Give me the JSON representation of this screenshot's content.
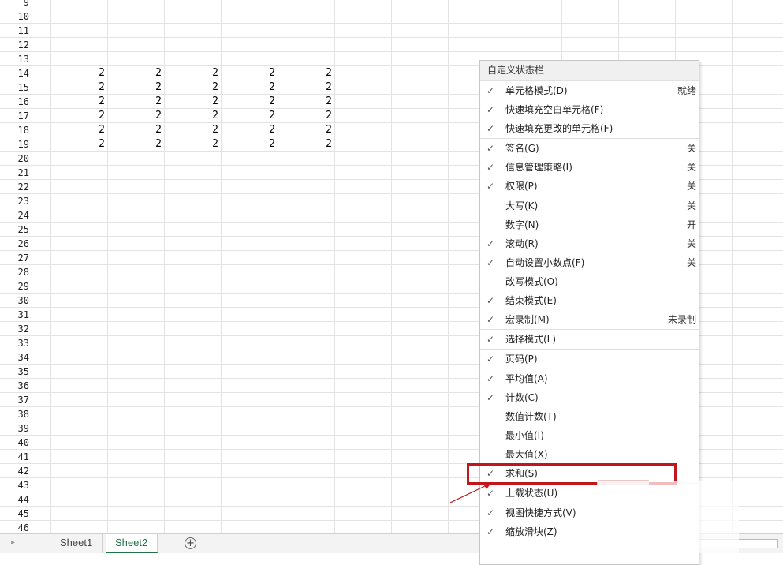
{
  "sheet": {
    "rows": [
      {
        "num": "9",
        "cells": []
      },
      {
        "num": "10",
        "cells": []
      },
      {
        "num": "11",
        "cells": []
      },
      {
        "num": "12",
        "cells": []
      },
      {
        "num": "13",
        "cells": []
      },
      {
        "num": "14",
        "cells": [
          "2",
          "2",
          "2",
          "2",
          "2"
        ]
      },
      {
        "num": "15",
        "cells": [
          "2",
          "2",
          "2",
          "2",
          "2"
        ]
      },
      {
        "num": "16",
        "cells": [
          "2",
          "2",
          "2",
          "2",
          "2"
        ]
      },
      {
        "num": "17",
        "cells": [
          "2",
          "2",
          "2",
          "2",
          "2"
        ]
      },
      {
        "num": "18",
        "cells": [
          "2",
          "2",
          "2",
          "2",
          "2"
        ]
      },
      {
        "num": "19",
        "cells": [
          "2",
          "2",
          "2",
          "2",
          "2"
        ]
      },
      {
        "num": "20",
        "cells": []
      },
      {
        "num": "21",
        "cells": []
      },
      {
        "num": "22",
        "cells": []
      },
      {
        "num": "23",
        "cells": []
      },
      {
        "num": "24",
        "cells": []
      },
      {
        "num": "25",
        "cells": []
      },
      {
        "num": "26",
        "cells": []
      },
      {
        "num": "27",
        "cells": []
      },
      {
        "num": "28",
        "cells": []
      },
      {
        "num": "29",
        "cells": []
      },
      {
        "num": "30",
        "cells": []
      },
      {
        "num": "31",
        "cells": []
      },
      {
        "num": "32",
        "cells": []
      },
      {
        "num": "33",
        "cells": []
      },
      {
        "num": "34",
        "cells": []
      },
      {
        "num": "35",
        "cells": []
      },
      {
        "num": "36",
        "cells": []
      },
      {
        "num": "37",
        "cells": []
      },
      {
        "num": "38",
        "cells": []
      },
      {
        "num": "39",
        "cells": []
      },
      {
        "num": "40",
        "cells": []
      },
      {
        "num": "41",
        "cells": []
      },
      {
        "num": "42",
        "cells": []
      },
      {
        "num": "43",
        "cells": []
      },
      {
        "num": "44",
        "cells": []
      },
      {
        "num": "45",
        "cells": []
      },
      {
        "num": "46",
        "cells": []
      }
    ]
  },
  "tabs": {
    "sheet1": "Sheet1",
    "sheet2": "Sheet2"
  },
  "icons": {
    "add_sheet": "plus-circle-icon",
    "nav": "chevron-right-icon",
    "check": "checkmark-icon"
  },
  "menu": {
    "title": "自定义状态栏",
    "items": [
      {
        "checked": true,
        "label": "单元格模式(D)",
        "value": "就绪",
        "sep": false
      },
      {
        "checked": true,
        "label": "快速填充空白单元格(F)",
        "value": "",
        "sep": false
      },
      {
        "checked": true,
        "label": "快速填充更改的单元格(F)",
        "value": "",
        "sep": false
      },
      {
        "checked": true,
        "label": "签名(G)",
        "value": "关",
        "sep": true
      },
      {
        "checked": true,
        "label": "信息管理策略(I)",
        "value": "关",
        "sep": false
      },
      {
        "checked": true,
        "label": "权限(P)",
        "value": "关",
        "sep": false
      },
      {
        "checked": false,
        "label": "大写(K)",
        "value": "关",
        "sep": true
      },
      {
        "checked": false,
        "label": "数字(N)",
        "value": "开",
        "sep": false
      },
      {
        "checked": true,
        "label": "滚动(R)",
        "value": "关",
        "sep": false
      },
      {
        "checked": true,
        "label": "自动设置小数点(F)",
        "value": "关",
        "sep": false
      },
      {
        "checked": false,
        "label": "改写模式(O)",
        "value": "",
        "sep": false
      },
      {
        "checked": true,
        "label": "结束模式(E)",
        "value": "",
        "sep": false
      },
      {
        "checked": true,
        "label": "宏录制(M)",
        "value": "未录制",
        "sep": false
      },
      {
        "checked": true,
        "label": "选择模式(L)",
        "value": "",
        "sep": true
      },
      {
        "checked": true,
        "label": "页码(P)",
        "value": "",
        "sep": true
      },
      {
        "checked": true,
        "label": "平均值(A)",
        "value": "",
        "sep": true
      },
      {
        "checked": true,
        "label": "计数(C)",
        "value": "",
        "sep": false
      },
      {
        "checked": false,
        "label": "数值计数(T)",
        "value": "",
        "sep": false
      },
      {
        "checked": false,
        "label": "最小值(I)",
        "value": "",
        "sep": false
      },
      {
        "checked": false,
        "label": "最大值(X)",
        "value": "",
        "sep": false
      },
      {
        "checked": true,
        "label": "求和(S)",
        "value": "",
        "sep": false
      },
      {
        "checked": true,
        "label": "上载状态(U)",
        "value": "",
        "sep": true
      },
      {
        "checked": true,
        "label": "视图快捷方式(V)",
        "value": "",
        "sep": true
      },
      {
        "checked": true,
        "label": "缩放滑块(Z)",
        "value": "",
        "sep": false
      }
    ]
  },
  "colors": {
    "highlight": "#c0161c",
    "active_tab": "#217346"
  }
}
